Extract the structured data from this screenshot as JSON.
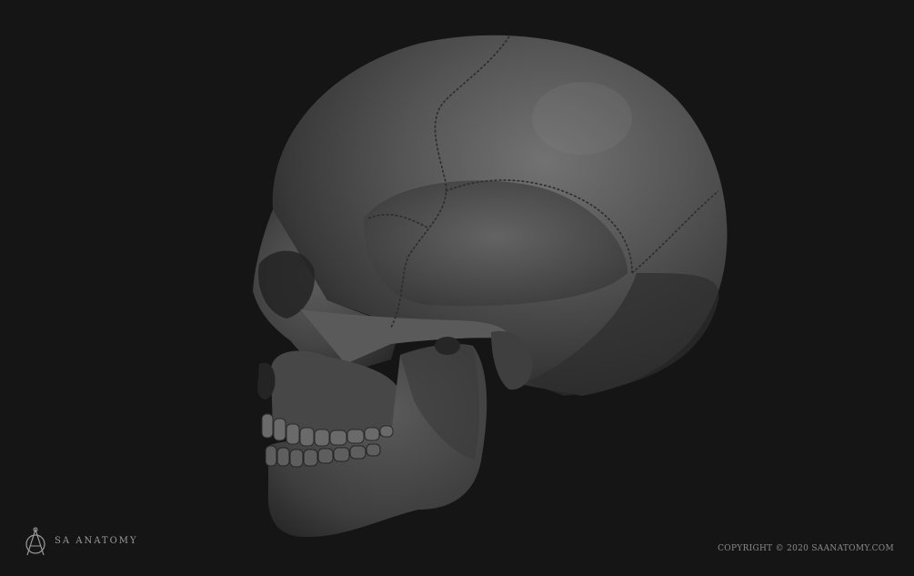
{
  "brand": {
    "name": "SA ANATOMY",
    "logo_icon": "sa-monogram-icon"
  },
  "footer": {
    "copyright": "COPYRIGHT © 2020 SAANATOMY.COM"
  },
  "colors": {
    "background": "#151515",
    "skull_light": "#6d6d6d",
    "skull_mid": "#4a4a4a",
    "skull_dark": "#2a2a2a",
    "text": "#9a9a9a"
  }
}
